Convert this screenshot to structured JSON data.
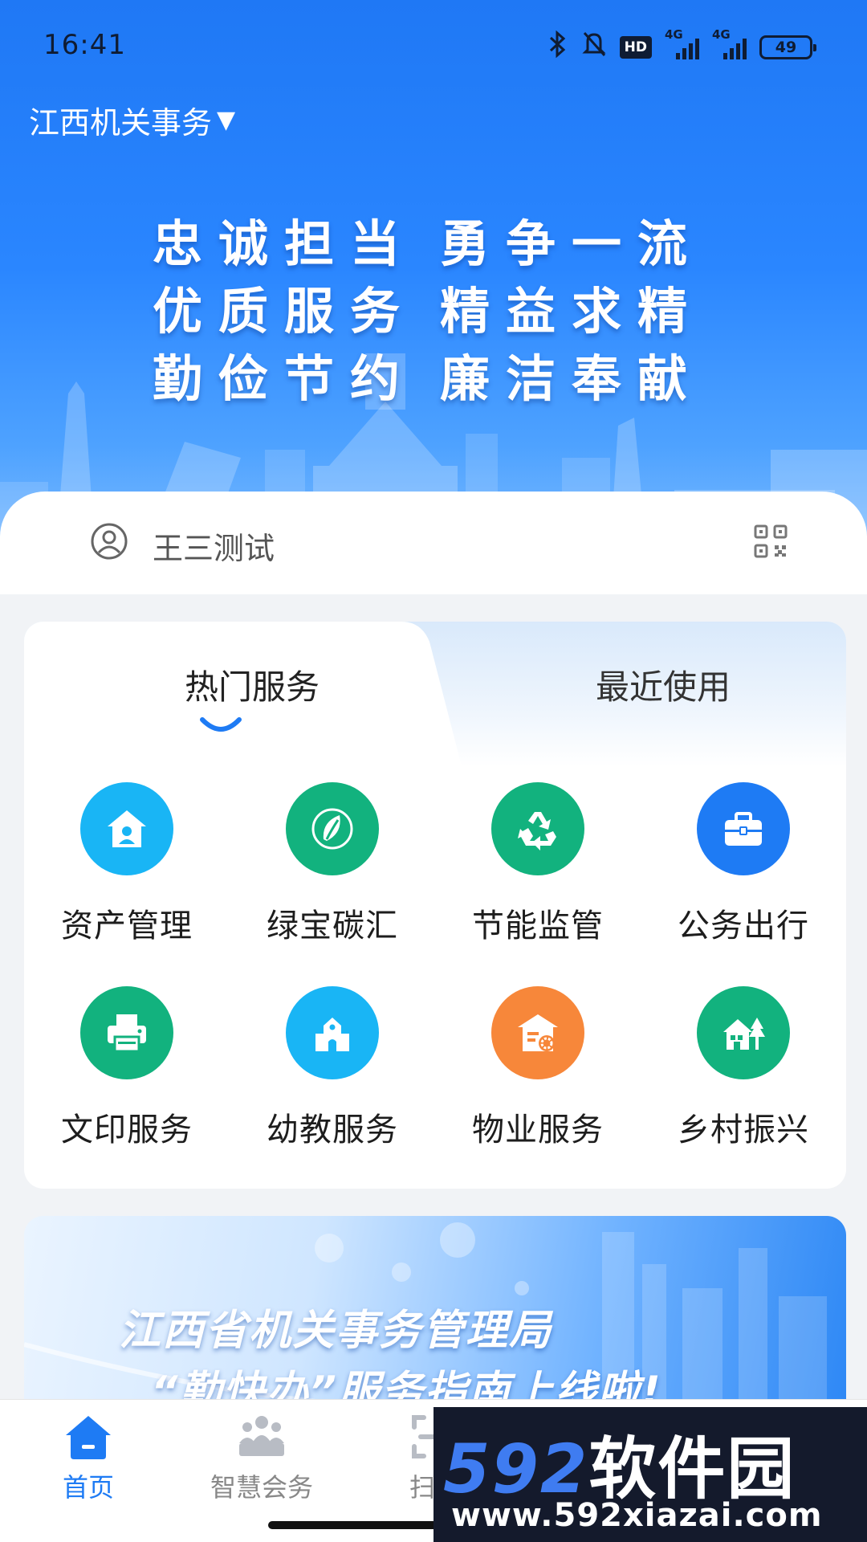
{
  "status_bar": {
    "time": "16:41",
    "battery": "49",
    "hd_badge": "HD",
    "sig1_label": "4G",
    "sig2_label": "4G",
    "icons": [
      "bluetooth-icon",
      "bell-off-icon",
      "signal-icon",
      "battery-icon"
    ]
  },
  "header": {
    "org_name": "江西机关事务"
  },
  "hero": {
    "slogan": [
      [
        "忠诚担当",
        "勇争一流"
      ],
      [
        "优质服务",
        "精益求精"
      ],
      [
        "勤俭节约",
        "廉洁奉献"
      ]
    ]
  },
  "user": {
    "name": "王三测试"
  },
  "services": {
    "tabs": [
      {
        "label": "热门服务",
        "active": true
      },
      {
        "label": "最近使用",
        "active": false
      }
    ],
    "items": [
      {
        "label": "资产管理",
        "icon": "house-user-icon",
        "color": "#19b5f5"
      },
      {
        "label": "绿宝碳汇",
        "icon": "leaf-icon",
        "color": "#12b27e"
      },
      {
        "label": "节能监管",
        "icon": "recycle-icon",
        "color": "#12b27e"
      },
      {
        "label": "公务出行",
        "icon": "briefcase-icon",
        "color": "#1e7bf4"
      },
      {
        "label": "文印服务",
        "icon": "printer-icon",
        "color": "#12b27e"
      },
      {
        "label": "幼教服务",
        "icon": "school-icon",
        "color": "#19b5f5"
      },
      {
        "label": "物业服务",
        "icon": "house-gear-icon",
        "color": "#f7873a"
      },
      {
        "label": "乡村振兴",
        "icon": "village-icon",
        "color": "#12b27e"
      }
    ]
  },
  "banner": {
    "line1": "江西省机关事务管理局",
    "line2": "“勤快办”服务指南上线啦!"
  },
  "bottom_nav": {
    "items": [
      {
        "label": "首页",
        "icon": "home-icon",
        "active": true
      },
      {
        "label": "智慧会务",
        "icon": "meeting-icon",
        "active": false
      },
      {
        "label": "扫码",
        "icon": "scan-icon",
        "active": false
      }
    ],
    "active_color": "#1e7bf4"
  },
  "watermark": {
    "logo_num": "592",
    "logo_cn": "软件园",
    "url": "www.592xiazai.com"
  },
  "colors": {
    "hero_top": "#1f78f5",
    "accent": "#1e7bf4"
  }
}
